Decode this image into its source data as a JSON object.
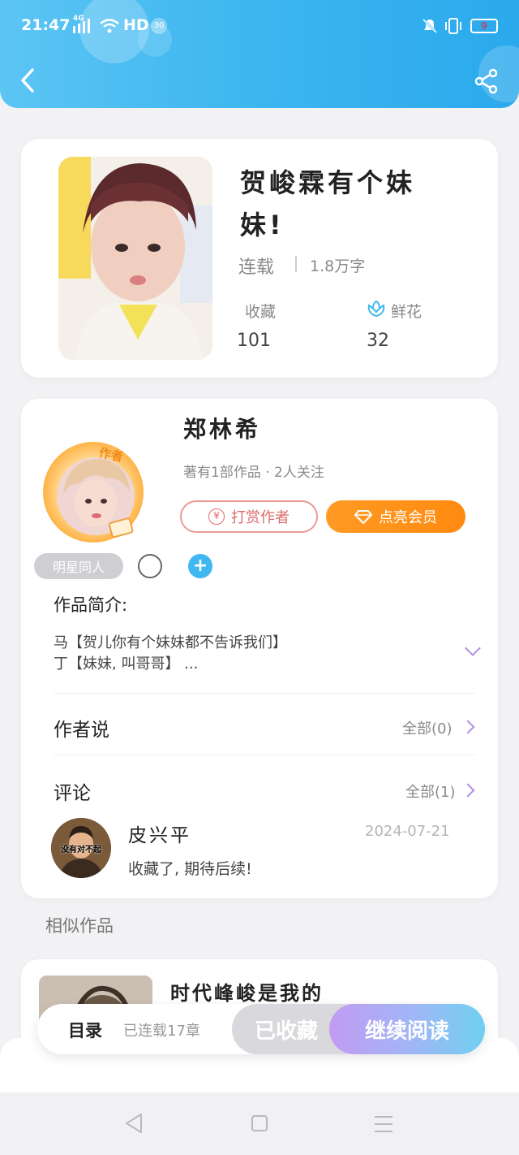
{
  "status_bar": {
    "time": "21:47",
    "network": "4G",
    "hd": "HD",
    "speed": "30",
    "battery": "9"
  },
  "header": {
    "back_icon": "back-chevron-icon",
    "share_icon": "share-icon"
  },
  "book": {
    "title": "贺峻霖有个妹妹!",
    "status": "连载",
    "word_count": "1.8万字",
    "favorites_label": "收藏",
    "favorites_value": "101",
    "flowers_label": "鲜花",
    "flowers_value": "32"
  },
  "author": {
    "name": "郑林希",
    "meta": "著有1部作品 · 2人关注",
    "badge": "作者",
    "tip_button": "打赏作者",
    "vip_button": "点亮会员"
  },
  "tags": {
    "category": "明星同人"
  },
  "intro": {
    "heading": "作品简介:",
    "line1": "马【贺儿你有个妹妹都不告诉我们】",
    "line2": "丁【妹妹, 叫哥哥】 ..."
  },
  "author_says": {
    "label": "作者说",
    "count": "全部(0)"
  },
  "comments": {
    "label": "评论",
    "count": "全部(1)",
    "item": {
      "user": "皮兴平",
      "avatar_caption": "没有对不起",
      "date": "2024-07-21",
      "text": "收藏了, 期待后续!"
    }
  },
  "similar": {
    "heading": "相似作品",
    "first_title": "时代峰峻是我的"
  },
  "bottom_bar": {
    "catalog": "目录",
    "chapters": "已连载17章",
    "collected": "已收藏",
    "continue": "继续阅读"
  },
  "colors": {
    "header_blue": "#3fb7f0",
    "vip_orange": "#ff9a24",
    "accent_purple": "#b08ee6",
    "tip_red": "#e06a6a"
  }
}
